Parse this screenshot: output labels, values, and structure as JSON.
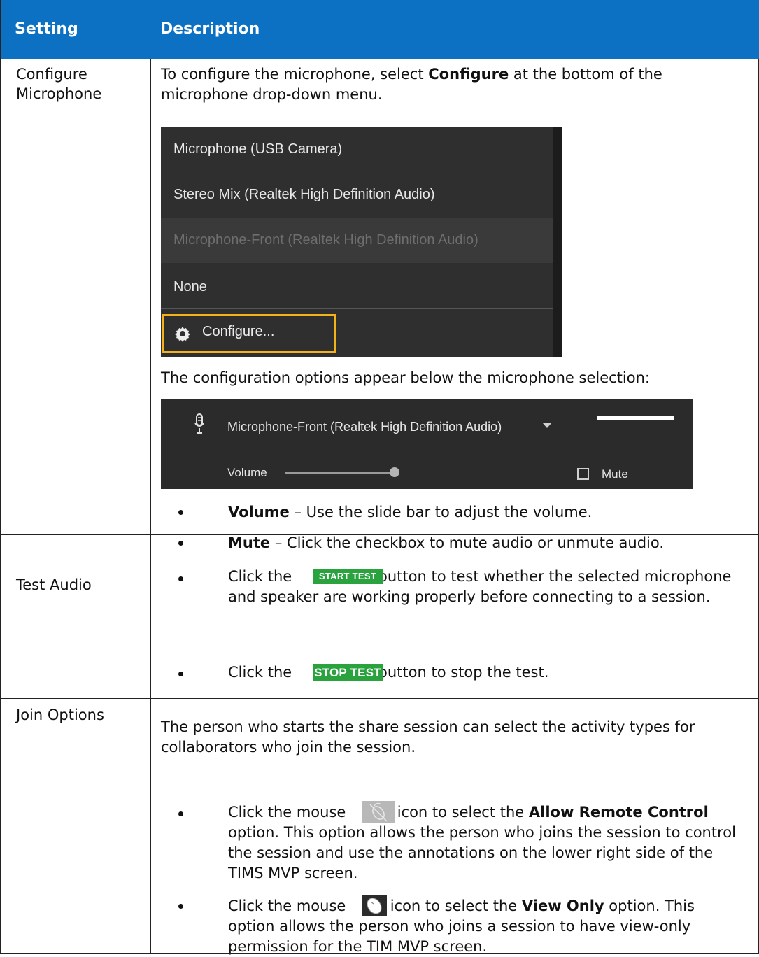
{
  "table": {
    "header": {
      "setting": "Setting",
      "description": "Description"
    },
    "rows": [
      {
        "setting": "Configure Microphone",
        "intro_before": "To configure the microphone, select ",
        "intro_bold": "Configure",
        "intro_after": " at the bottom of the microphone drop-down menu.",
        "dropdown": {
          "items": [
            "Microphone (USB Camera)",
            "Stereo Mix (Realtek High Definition Audio)",
            "Microphone-Front (Realtek High Definition Audio)",
            "None"
          ],
          "disabled_item_index": 2,
          "configure_label": "Configure...",
          "highlight_color": "#f2b21a"
        },
        "config_caption": "The configuration options appear below the microphone selection:",
        "config_panel": {
          "selected_mic": "Microphone-Front (Realtek High Definition Audio)",
          "volume_label": "Volume",
          "volume_level": 1.0,
          "mute_label": "Mute",
          "mute_checked": false
        },
        "bullets": [
          {
            "bold": "Volume",
            "text": " – Use the slide bar to adjust the volume."
          },
          {
            "bold": "Mute",
            "text": " – Click the checkbox to mute audio or unmute audio."
          }
        ]
      },
      {
        "setting": "Test Audio",
        "bullets": [
          {
            "before": "Click the ",
            "button": "START TEST",
            "after": " button to test whether the selected microphone and speaker are working properly before connecting to a session."
          },
          {
            "before": "Click the ",
            "button": "STOP TEST",
            "after": " button to stop the test."
          }
        ],
        "button_color": "#2aa33f"
      },
      {
        "setting": "Join Options",
        "intro": "The person who starts the share session can select the activity types for collaborators who join the session.",
        "bullets": [
          {
            "before": "Click the mouse ",
            "icon": "mouse-crossed-icon",
            "mid": " icon to select the ",
            "bold": "Allow Remote Control",
            "after": " option. This option allows the person who joins the session to control the session and use the annotations on the lower right side of the TIMS MVP screen."
          },
          {
            "before": "Click the mouse ",
            "icon": "mouse-icon",
            "mid": " icon to select the ",
            "bold": "View Only",
            "after": " option. This option allows the person who joins a session to have view-only permission for the TIM MVP screen."
          }
        ]
      }
    ],
    "header_color": "#0c70c3"
  }
}
